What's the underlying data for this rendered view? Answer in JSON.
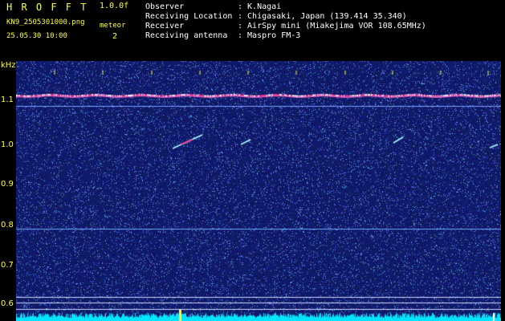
{
  "app": {
    "logo": "H R O F F T",
    "version": "1.0.0f",
    "filename": "KN9_2505301000.png",
    "datetime": "25.05.30 10:00",
    "meteor_label": "meteor",
    "meteor_count": "2"
  },
  "info": {
    "observer_label": "Observer",
    "observer_value": ": K.Nagai",
    "location_label": "Receiving Location",
    "location_value": ": Chigasaki, Japan (139.414 35.340)",
    "receiver_label": "Receiver",
    "receiver_value": ": AirSpy mini (Miakejima VOR 108.65MHz)",
    "antenna_label": "Receiving antenna",
    "antenna_value": ": Maspro FM-3"
  },
  "axis": {
    "y_unit": "kHz",
    "y_ticks": [
      "1.1",
      "1.0",
      "0.9",
      "0.8",
      "0.7",
      "0.6"
    ],
    "x_ticks": [
      "1001",
      "1002",
      "1003",
      "1004",
      "1005",
      "1006",
      "1007",
      "1008",
      "1009",
      "1010"
    ]
  },
  "colors": {
    "background": "#000000",
    "waterfall_base": "#0a0f5a",
    "header_text": "#ffff33",
    "info_text": "#ffffff",
    "carrier": "#ff3399",
    "meteor_trace": "#aaffff",
    "signal_trace": "#00e5ff"
  }
}
